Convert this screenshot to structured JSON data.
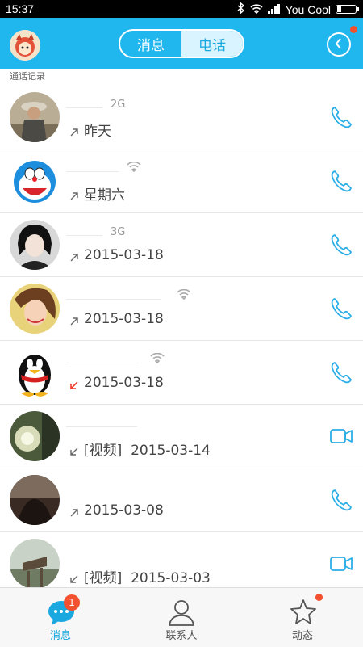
{
  "status_bar": {
    "time": "15:37",
    "carrier": "You Cool"
  },
  "header": {
    "tabs": {
      "messages": "消息",
      "calls": "电话"
    },
    "active_tab": "calls"
  },
  "section_label": "通话记录",
  "colors": {
    "brand": "#20b7ef",
    "accent": "#1aa8e0",
    "badge": "#f2502f"
  },
  "call_log": [
    {
      "network": "2G",
      "direction": "outgoing",
      "date": "昨天",
      "type": "voice",
      "action_icon": "phone-icon"
    },
    {
      "network": "wifi",
      "direction": "outgoing",
      "date": "星期六",
      "type": "voice",
      "action_icon": "phone-icon"
    },
    {
      "network": "3G",
      "direction": "outgoing",
      "date": "2015-03-18",
      "type": "voice",
      "action_icon": "phone-icon"
    },
    {
      "network": "wifi",
      "direction": "outgoing",
      "date": "2015-03-18",
      "type": "voice",
      "action_icon": "phone-icon"
    },
    {
      "network": "wifi",
      "direction": "missed",
      "date": "2015-03-18",
      "type": "voice",
      "action_icon": "phone-icon"
    },
    {
      "network": "",
      "direction": "incoming",
      "date": "[视频]  2015-03-14",
      "type": "video",
      "action_icon": "video-camera-icon"
    },
    {
      "network": "",
      "direction": "outgoing",
      "date": "2015-03-08",
      "type": "voice",
      "action_icon": "phone-icon"
    },
    {
      "network": "",
      "direction": "incoming",
      "date": "[视频]  2015-03-03",
      "type": "video",
      "action_icon": "video-camera-icon"
    }
  ],
  "tab_bar": {
    "items": [
      {
        "label": "消息",
        "icon": "chat-bubble-icon",
        "badge": "1"
      },
      {
        "label": "联系人",
        "icon": "contacts-person-icon"
      },
      {
        "label": "动态",
        "icon": "star-icon"
      }
    ]
  }
}
